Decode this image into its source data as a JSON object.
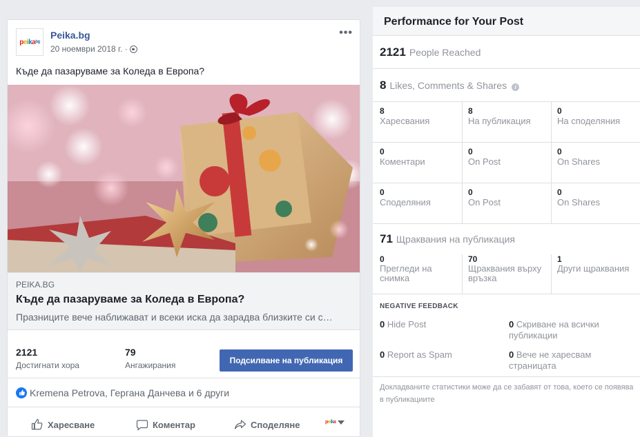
{
  "post": {
    "page_name": "Peika.bg",
    "logo_text": [
      "p",
      "e",
      "i",
      "k",
      "a"
    ],
    "logo_sup": "bg",
    "date": "20 ноември 2018 г. ·",
    "text": "Къде да пазаруваме за Коледа в Европа?",
    "link": {
      "domain": "PEIKA.BG",
      "title": "Къде да пазаруваме за Коледа в Европа?",
      "description": "Празниците вече наближават и всеки иска да зарадва близките си с…"
    },
    "insights": {
      "reached_value": "2121",
      "reached_label": "Достигнати хора",
      "engagement_value": "79",
      "engagement_label": "Ангажирания",
      "boost_label": "Подсилване на публикация"
    },
    "reactions_text": "Kremena Petrova, Гергана Данчева и 6 други",
    "actions": {
      "like": "Харесване",
      "comment": "Коментар",
      "share": "Споделяне"
    },
    "mini_logo": "peika"
  },
  "performance": {
    "title": "Performance for Your Post",
    "people_reached": {
      "value": "2121",
      "label": "People Reached"
    },
    "engagement": {
      "value": "8",
      "label": "Likes, Comments & Shares"
    },
    "grid": [
      [
        {
          "value": "8",
          "label": "Харесвания"
        },
        {
          "value": "8",
          "label": "На публикация"
        },
        {
          "value": "0",
          "label": "На споделяния"
        }
      ],
      [
        {
          "value": "0",
          "label": "Коментари"
        },
        {
          "value": "0",
          "label": "On Post"
        },
        {
          "value": "0",
          "label": "On Shares"
        }
      ],
      [
        {
          "value": "0",
          "label": "Споделяния"
        },
        {
          "value": "0",
          "label": "On Post"
        },
        {
          "value": "0",
          "label": "On Shares"
        }
      ]
    ],
    "post_clicks": {
      "value": "71",
      "label": "Щраквания на публикация"
    },
    "clicks": [
      {
        "value": "0",
        "label": "Прегледи на снимка"
      },
      {
        "value": "70",
        "label": "Щраквания върху връзка"
      },
      {
        "value": "1",
        "label": "Други щраквания"
      }
    ],
    "negative": {
      "title": "NEGATIVE FEEDBACK",
      "hide_post": {
        "value": "0",
        "label": "Hide Post"
      },
      "hide_all": {
        "value": "0",
        "label": "Скриване на всички публикации"
      },
      "spam": {
        "value": "0",
        "label": "Report as Spam"
      },
      "unlike": {
        "value": "0",
        "label": "Вече не харесвам страницата"
      }
    },
    "footnote": "Докладваните статистики може да се забавят от това, което се появява в публикациите"
  }
}
